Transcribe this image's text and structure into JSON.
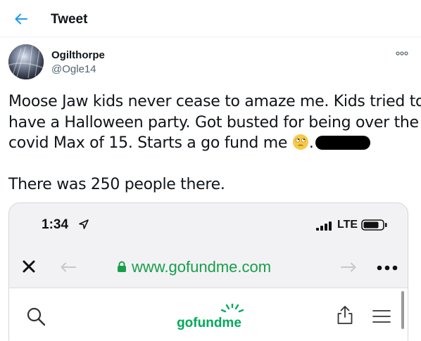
{
  "header": {
    "title": "Tweet",
    "back_icon": "arrow-left-icon",
    "accent": "#1d9bf0"
  },
  "author": {
    "name": "Ogilthorpe",
    "handle": "@Ogle14"
  },
  "tweet": {
    "line1": "Moose Jaw kids never cease to amaze me. Kids tried to",
    "line2": "have a Halloween party. Got busted for being over the",
    "line3": "covid Max of 15. Starts a go fund me",
    "line3_after_emoji": ".",
    "line5": "There was 250 people there.",
    "emoji": "face-with-rolling-eyes-icon"
  },
  "screenshot": {
    "status": {
      "time": "1:34",
      "network": "LTE"
    },
    "browser": {
      "url": "www.gofundme.com",
      "url_color": "#179e4b"
    },
    "site": {
      "logo_text": "gofundme",
      "brand_color": "#02a95c"
    }
  }
}
